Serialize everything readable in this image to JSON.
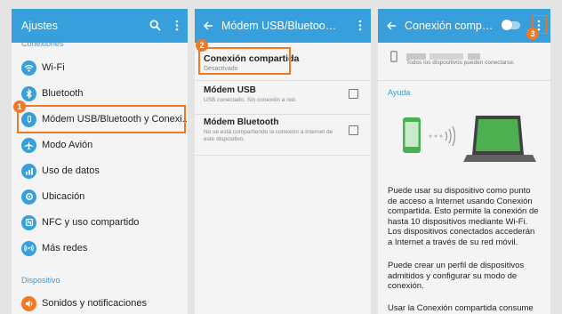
{
  "panel1": {
    "title": "Ajustes",
    "section_connections": "Conexiones",
    "items": [
      {
        "label": "Wi-Fi",
        "icon": "wifi-icon",
        "color": "#37a0dc"
      },
      {
        "label": "Bluetooth",
        "icon": "bluetooth-icon",
        "color": "#37a0dc"
      },
      {
        "label": "Módem USB/Bluetooth y Conexi...",
        "icon": "tethering-icon",
        "color": "#37a0dc"
      },
      {
        "label": "Modo Avión",
        "icon": "airplane-icon",
        "color": "#37a0dc"
      },
      {
        "label": "Uso de datos",
        "icon": "data-usage-icon",
        "color": "#37a0dc"
      },
      {
        "label": "Ubicación",
        "icon": "location-icon",
        "color": "#37a0dc"
      },
      {
        "label": "NFC y uso compartido",
        "icon": "nfc-icon",
        "color": "#37a0dc"
      },
      {
        "label": "Más redes",
        "icon": "more-networks-icon",
        "color": "#37a0dc"
      }
    ],
    "section_device": "Dispositivo",
    "device_items": [
      {
        "label": "Sonidos y notificaciones",
        "icon": "sound-icon",
        "color": "#ee7a27"
      }
    ],
    "badge": "1"
  },
  "panel2": {
    "title": "Módem USB/Bluetooth y...",
    "hotspot": {
      "title": "Conexión compartida",
      "sub": "Desactivado"
    },
    "usb": {
      "title": "Módem USB",
      "sub": "USB conectado. Sin conexión a red."
    },
    "bt": {
      "title": "Módem Bluetooth",
      "sub": "No se está compartiendo la conexión a Internet de este dispositivo."
    },
    "badge": "2"
  },
  "panel3": {
    "title": "Conexión compar...",
    "devices_text": "Todos los dispositivos pueden conectarse.",
    "help_label": "Ayuda",
    "para1": "Puede usar su dispositivo como punto de acceso a Internet usando Conexión compartida. Esto permite la conexión de hasta 10 dispositivos mediante Wi-Fi. Los dispositivos conectados accederán a Internet a través de su red móvil.",
    "para2": "Puede crear un perfil de dispositivos admitidos y configurar su modo de conexión.",
    "para3": "Usar la Conexión compartida consume",
    "toggle_on": false,
    "badge": "3"
  },
  "colors": {
    "accent": "#37a0dc",
    "highlight": "#ee7a27",
    "phone": "#4caf50"
  }
}
